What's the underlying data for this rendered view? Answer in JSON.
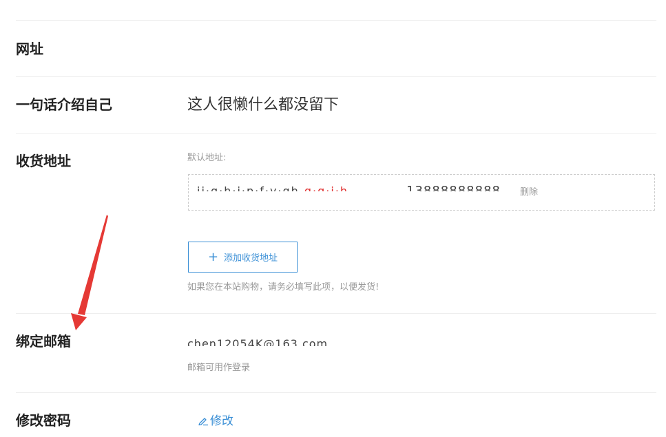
{
  "profile": {
    "website": {
      "label": "网址"
    },
    "bio": {
      "label": "一句话介绍自己",
      "value": "这人很懒什么都没留下"
    },
    "shipping": {
      "label": "收货地址",
      "default_label": "默认地址:",
      "address_masked": "ji·g·h·i·p·f·y·gh",
      "address_red_masked": "g·g·i·h",
      "phone_masked": "13888888888",
      "delete_label": "删除",
      "add_button_label": "添加收货地址",
      "hint": "如果您在本站购物，请务必填写此项，以便发货!"
    },
    "email": {
      "label": "绑定邮箱",
      "value_masked": "chen12054K@163.com",
      "hint": "邮箱可用作登录"
    },
    "password": {
      "label": "修改密码",
      "edit_label": "修改"
    }
  },
  "colors": {
    "accent": "#3a8fd6",
    "annotation_arrow": "#e53935",
    "divider": "#eeeeee",
    "muted_text": "#999999"
  }
}
